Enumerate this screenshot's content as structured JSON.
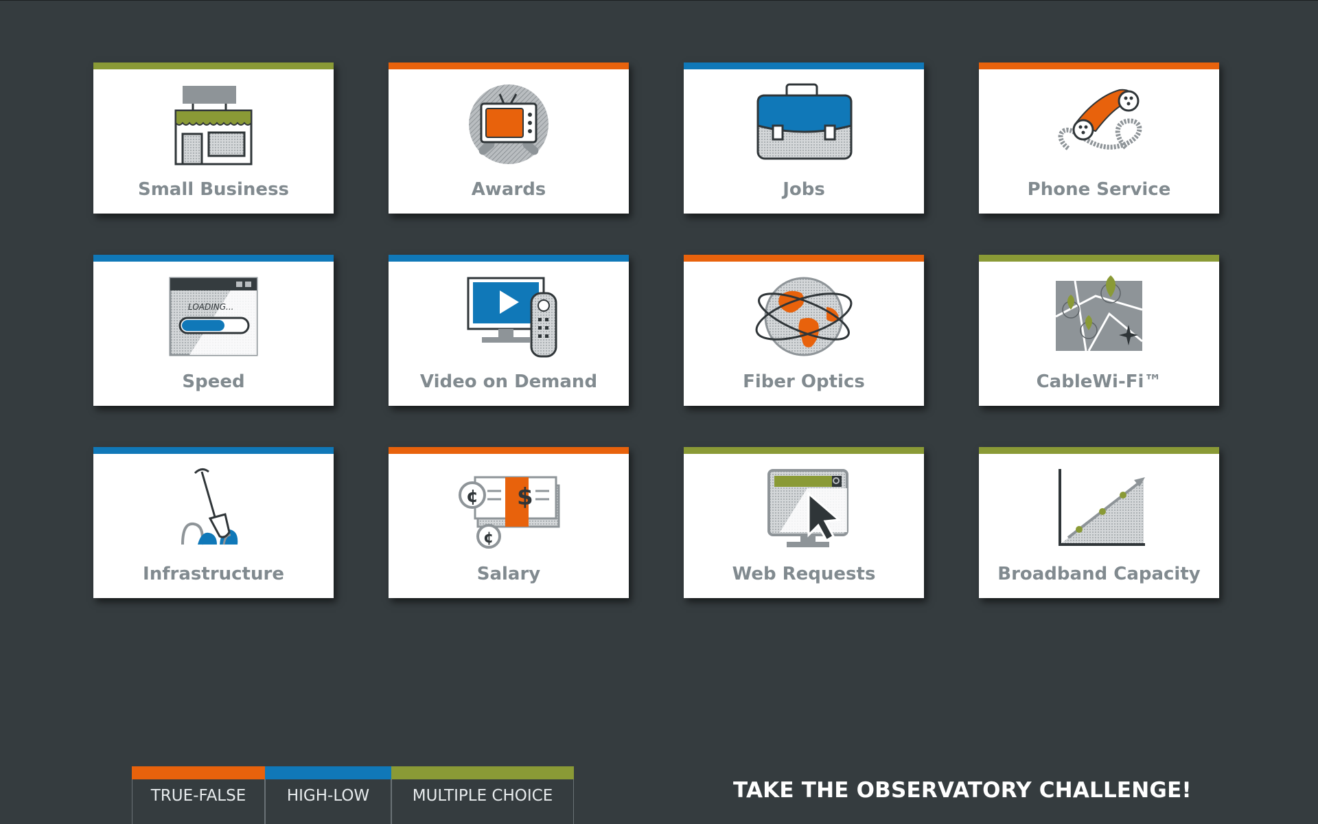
{
  "colors": {
    "background": "#353c3f",
    "green": "#8a9a36",
    "orange": "#e8620c",
    "blue": "#1078b8",
    "label_gray": "#818a8f"
  },
  "tiles": [
    {
      "label": "Small Business",
      "icon": "storefront-icon",
      "accent": "green"
    },
    {
      "label": "Awards",
      "icon": "tv-award-icon",
      "accent": "orange"
    },
    {
      "label": "Jobs",
      "icon": "briefcase-icon",
      "accent": "blue"
    },
    {
      "label": "Phone Service",
      "icon": "phone-handset-icon",
      "accent": "orange"
    },
    {
      "label": "Speed",
      "icon": "loading-window-icon",
      "accent": "blue"
    },
    {
      "label": "Video on Demand",
      "icon": "tv-remote-icon",
      "accent": "blue"
    },
    {
      "label": "Fiber Optics",
      "icon": "globe-cables-icon",
      "accent": "orange"
    },
    {
      "label": "CableWi-Fi™",
      "icon": "map-pins-icon",
      "accent": "green"
    },
    {
      "label": "Infrastructure",
      "icon": "shovel-icon",
      "accent": "blue"
    },
    {
      "label": "Salary",
      "icon": "paycheck-icon",
      "accent": "orange"
    },
    {
      "label": "Web Requests",
      "icon": "browser-cursor-icon",
      "accent": "green"
    },
    {
      "label": "Broadband Capacity",
      "icon": "growth-chart-icon",
      "accent": "green"
    }
  ],
  "icon_texts": {
    "loading": "LOADING..."
  },
  "modes": [
    {
      "label": "TRUE-FALSE",
      "accent": "orange"
    },
    {
      "label": "HIGH-LOW",
      "accent": "blue"
    },
    {
      "label": "MULTIPLE CHOICE",
      "accent": "green"
    }
  ],
  "challenge": "TAKE THE OBSERVATORY CHALLENGE!"
}
